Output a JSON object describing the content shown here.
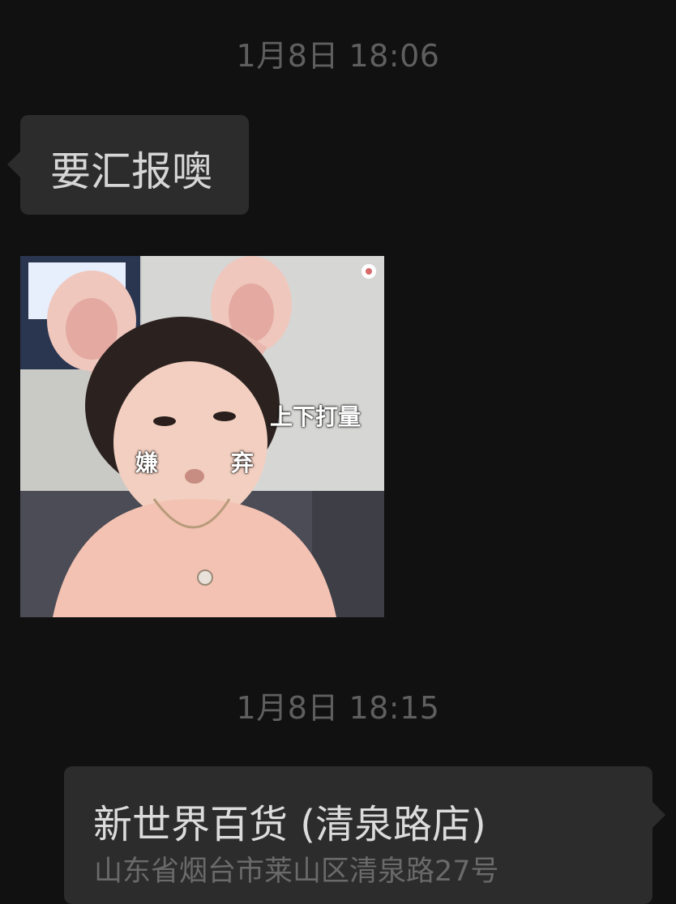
{
  "chat": {
    "timestamp_1": "1月8日 18:06",
    "message_1": "要汇报噢",
    "sticker": {
      "caption_top": "上下打量",
      "caption_left": "嫌",
      "caption_right": "弃"
    },
    "timestamp_2": "1月8日 18:15",
    "location": {
      "name": "新世界百货 (清泉路店)",
      "address": "山东省烟台市莱山区清泉路27号"
    }
  },
  "colors": {
    "background": "#111111",
    "bubble": "#2c2c2c",
    "timestamp": "#5f5f5f",
    "secondary_text": "#6a6a6a"
  }
}
